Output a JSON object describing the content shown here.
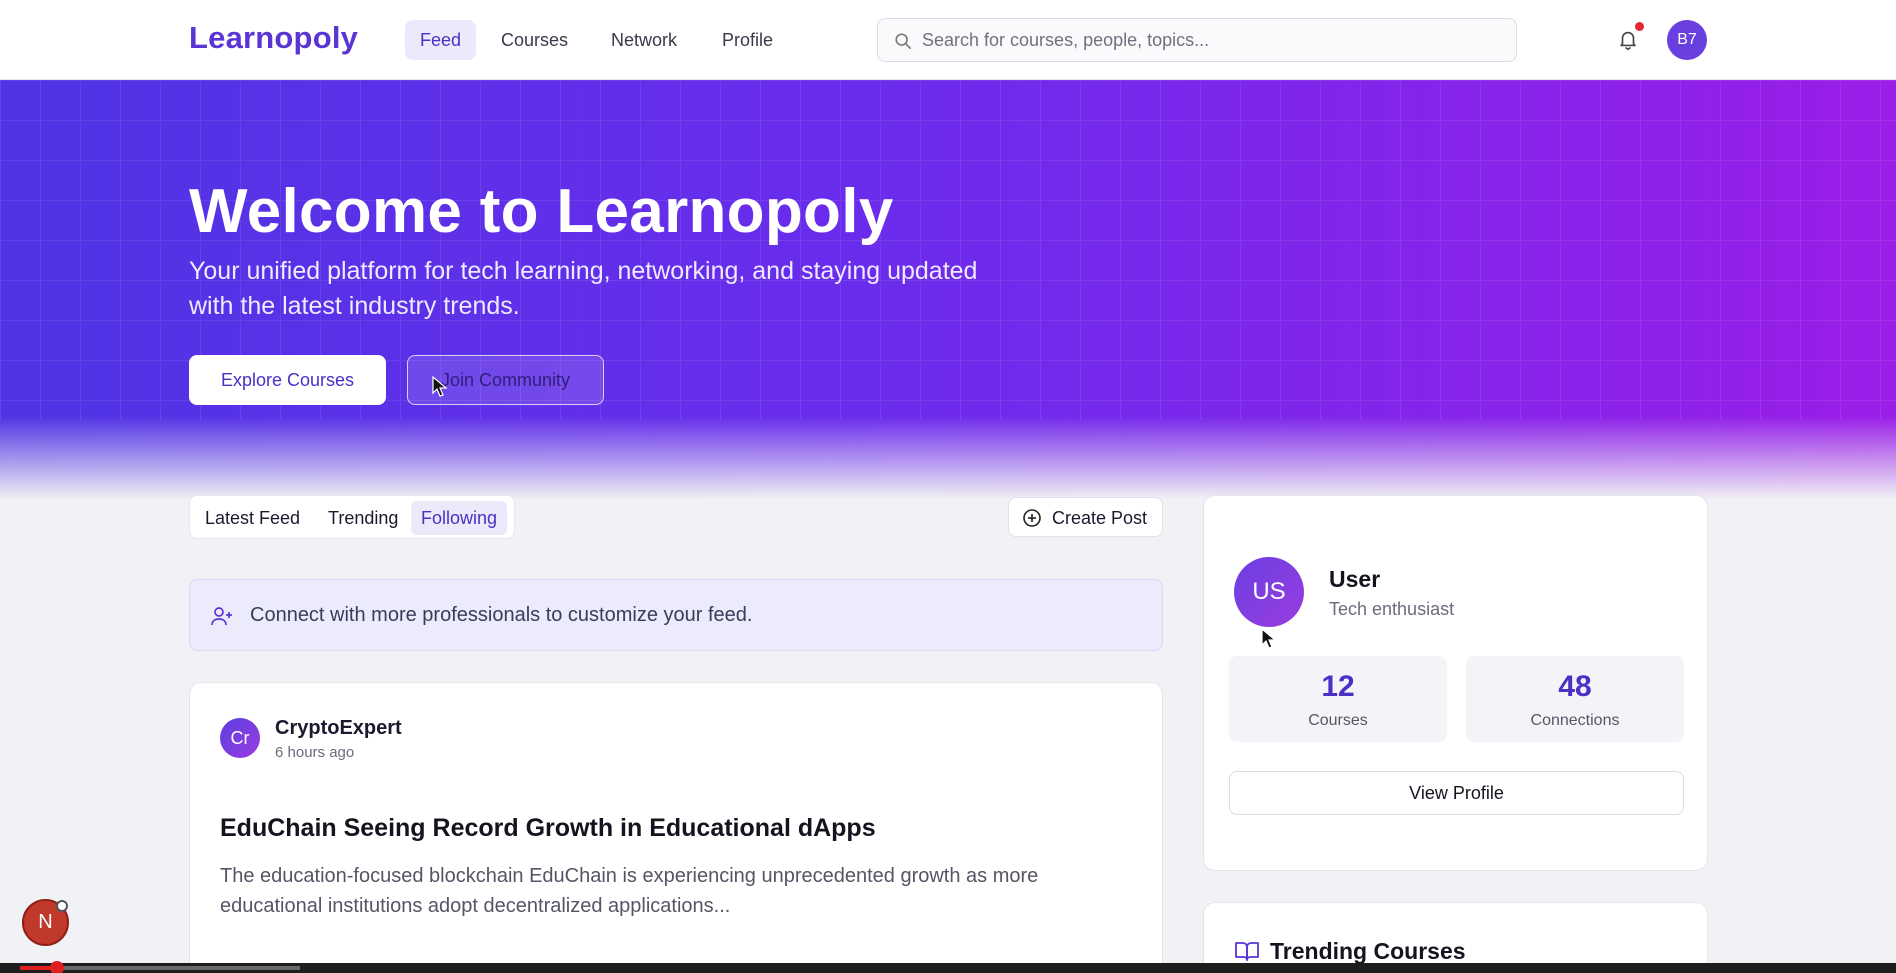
{
  "nav": {
    "logo": "Learnopoly",
    "links": [
      {
        "label": "Feed",
        "active": true
      },
      {
        "label": "Courses",
        "active": false
      },
      {
        "label": "Network",
        "active": false
      },
      {
        "label": "Profile",
        "active": false
      }
    ],
    "search_placeholder": "Search for courses, people, topics...",
    "notifications_icon": "bell-icon",
    "user_initials": "B7"
  },
  "hero": {
    "title": "Welcome to Learnopoly",
    "subtitle": "Your unified platform for tech learning, networking, and staying updated with the latest industry trends.",
    "primary_button": "Explore Courses",
    "secondary_button": "Join Community"
  },
  "feed": {
    "tabs": [
      {
        "label": "Latest Feed",
        "active": false
      },
      {
        "label": "Trending",
        "active": false
      },
      {
        "label": "Following",
        "active": true
      }
    ],
    "create_post_label": "Create Post",
    "notice_text": "Connect with more professionals to customize your feed.",
    "post": {
      "avatar_initials": "Cr",
      "author": "CryptoExpert",
      "time": "6 hours ago",
      "title": "EduChain Seeing Record Growth in Educational dApps",
      "body": "The education-focused blockchain EduChain is experiencing unprecedented growth as more educational institutions adopt decentralized applications..."
    }
  },
  "sidebar": {
    "profile": {
      "initials": "US",
      "name": "User",
      "tagline": "Tech enthusiast",
      "stats": [
        {
          "value": "12",
          "label": "Courses"
        },
        {
          "value": "48",
          "label": "Connections"
        }
      ],
      "view_profile_label": "View Profile"
    },
    "trending_title": "Trending Courses"
  },
  "overlay": {
    "badge_letter": "N",
    "video_progress_fraction": 0.02
  },
  "colors": {
    "brand": "#5b34d6",
    "hero_start": "#4f34e4",
    "hero_end": "#9a1ee8",
    "notification_dot": "#e4262e"
  }
}
